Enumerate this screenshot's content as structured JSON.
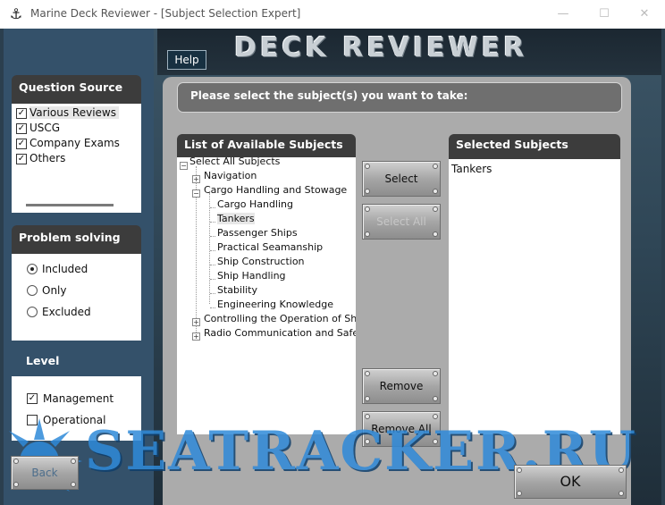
{
  "window": {
    "title": "Marine Deck Reviewer - [Subject Selection Expert]",
    "minimize": "—",
    "maximize": "☐",
    "close": "✕"
  },
  "header": {
    "logo": "DECK REVIEWER",
    "help": "Help"
  },
  "prompt": "Please select the subject(s) you want to take:",
  "available": {
    "title": "List of Available Subjects",
    "root": "Select All Subjects",
    "items": [
      {
        "label": "Navigation",
        "level": 1,
        "toggle": "+"
      },
      {
        "label": "Cargo Handling and Stowage",
        "level": 1,
        "toggle": "−"
      },
      {
        "label": "Cargo Handling",
        "level": 2
      },
      {
        "label": "Tankers",
        "level": 2,
        "selected": true
      },
      {
        "label": "Passenger Ships",
        "level": 2
      },
      {
        "label": "Practical Seamanship",
        "level": 2
      },
      {
        "label": "Ship Construction",
        "level": 2
      },
      {
        "label": "Ship Handling",
        "level": 2
      },
      {
        "label": "Stability",
        "level": 2
      },
      {
        "label": "Engineering Knowledge",
        "level": 2
      },
      {
        "label": "Controlling the Operation of Ship ar",
        "level": 1,
        "toggle": "+"
      },
      {
        "label": "Radio Communication and Safety",
        "level": 1,
        "toggle": "+"
      }
    ]
  },
  "selected": {
    "title": "Selected Subjects",
    "items": [
      "Tankers"
    ]
  },
  "buttons": {
    "select": "Select",
    "select_all": "Select All",
    "remove": "Remove",
    "remove_all": "Remove All",
    "back": "Back",
    "ok": "OK"
  },
  "question_source": {
    "title": "Question Source",
    "options": [
      {
        "label": "Various Reviews",
        "checked": true
      },
      {
        "label": "USCG",
        "checked": true
      },
      {
        "label": "Company Exams",
        "checked": true
      },
      {
        "label": "Others",
        "checked": true
      }
    ]
  },
  "problem_solving": {
    "title": "Problem solving",
    "options": [
      {
        "label": "Included",
        "selected": true
      },
      {
        "label": "Only",
        "selected": false
      },
      {
        "label": "Excluded",
        "selected": false
      }
    ]
  },
  "level": {
    "title": "Level",
    "options": [
      {
        "label": "Management",
        "checked": true
      },
      {
        "label": "Operational",
        "checked": false
      }
    ]
  },
  "watermark": "SEATRACKER.RU",
  "icons": {
    "app": "anchor-icon"
  }
}
